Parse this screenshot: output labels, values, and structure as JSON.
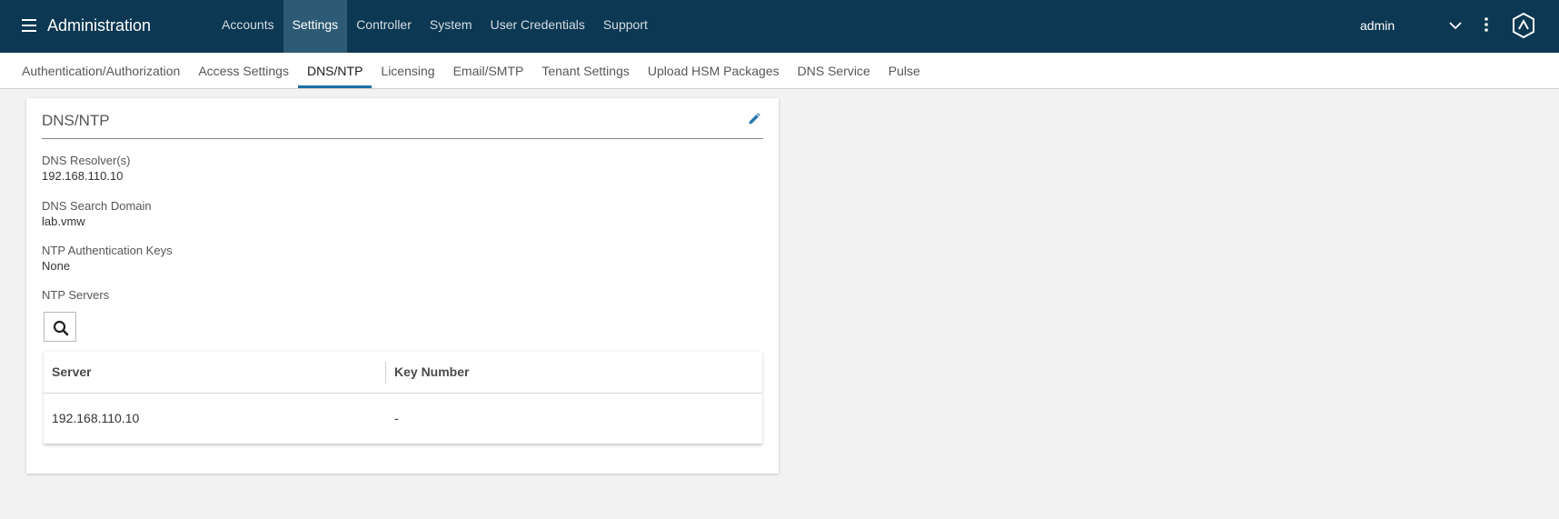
{
  "header": {
    "title": "Administration",
    "nav": [
      {
        "label": "Accounts",
        "active": false
      },
      {
        "label": "Settings",
        "active": true
      },
      {
        "label": "Controller",
        "active": false
      },
      {
        "label": "System",
        "active": false
      },
      {
        "label": "User Credentials",
        "active": false
      },
      {
        "label": "Support",
        "active": false
      }
    ],
    "user": "admin",
    "icons": [
      "menu-icon",
      "chevron-down-icon",
      "more-vertical-icon",
      "brand-logo-icon"
    ]
  },
  "tabs": [
    {
      "label": "Authentication/Authorization",
      "active": false
    },
    {
      "label": "Access Settings",
      "active": false
    },
    {
      "label": "DNS/NTP",
      "active": true
    },
    {
      "label": "Licensing",
      "active": false
    },
    {
      "label": "Email/SMTP",
      "active": false
    },
    {
      "label": "Tenant Settings",
      "active": false
    },
    {
      "label": "Upload HSM Packages",
      "active": false
    },
    {
      "label": "DNS Service",
      "active": false
    },
    {
      "label": "Pulse",
      "active": false
    }
  ],
  "card": {
    "title": "DNS/NTP",
    "fields": {
      "dns_resolvers": {
        "label": "DNS Resolver(s)",
        "value": "192.168.110.10"
      },
      "dns_search_domain": {
        "label": "DNS Search Domain",
        "value": "lab.vmw"
      },
      "ntp_auth_keys": {
        "label": "NTP Authentication Keys",
        "value": "None"
      },
      "ntp_servers": {
        "label": "NTP Servers"
      }
    },
    "table": {
      "columns": [
        "Server",
        "Key Number"
      ],
      "rows": [
        [
          "192.168.110.10",
          "-"
        ]
      ]
    }
  },
  "colors": {
    "header_bg": "#0c3853",
    "active_nav_bg": "#2d5a74",
    "active_tab_underline": "#1d6fa5",
    "edit_icon": "#2a7ab0",
    "page_bg": "#f2f2f2"
  }
}
